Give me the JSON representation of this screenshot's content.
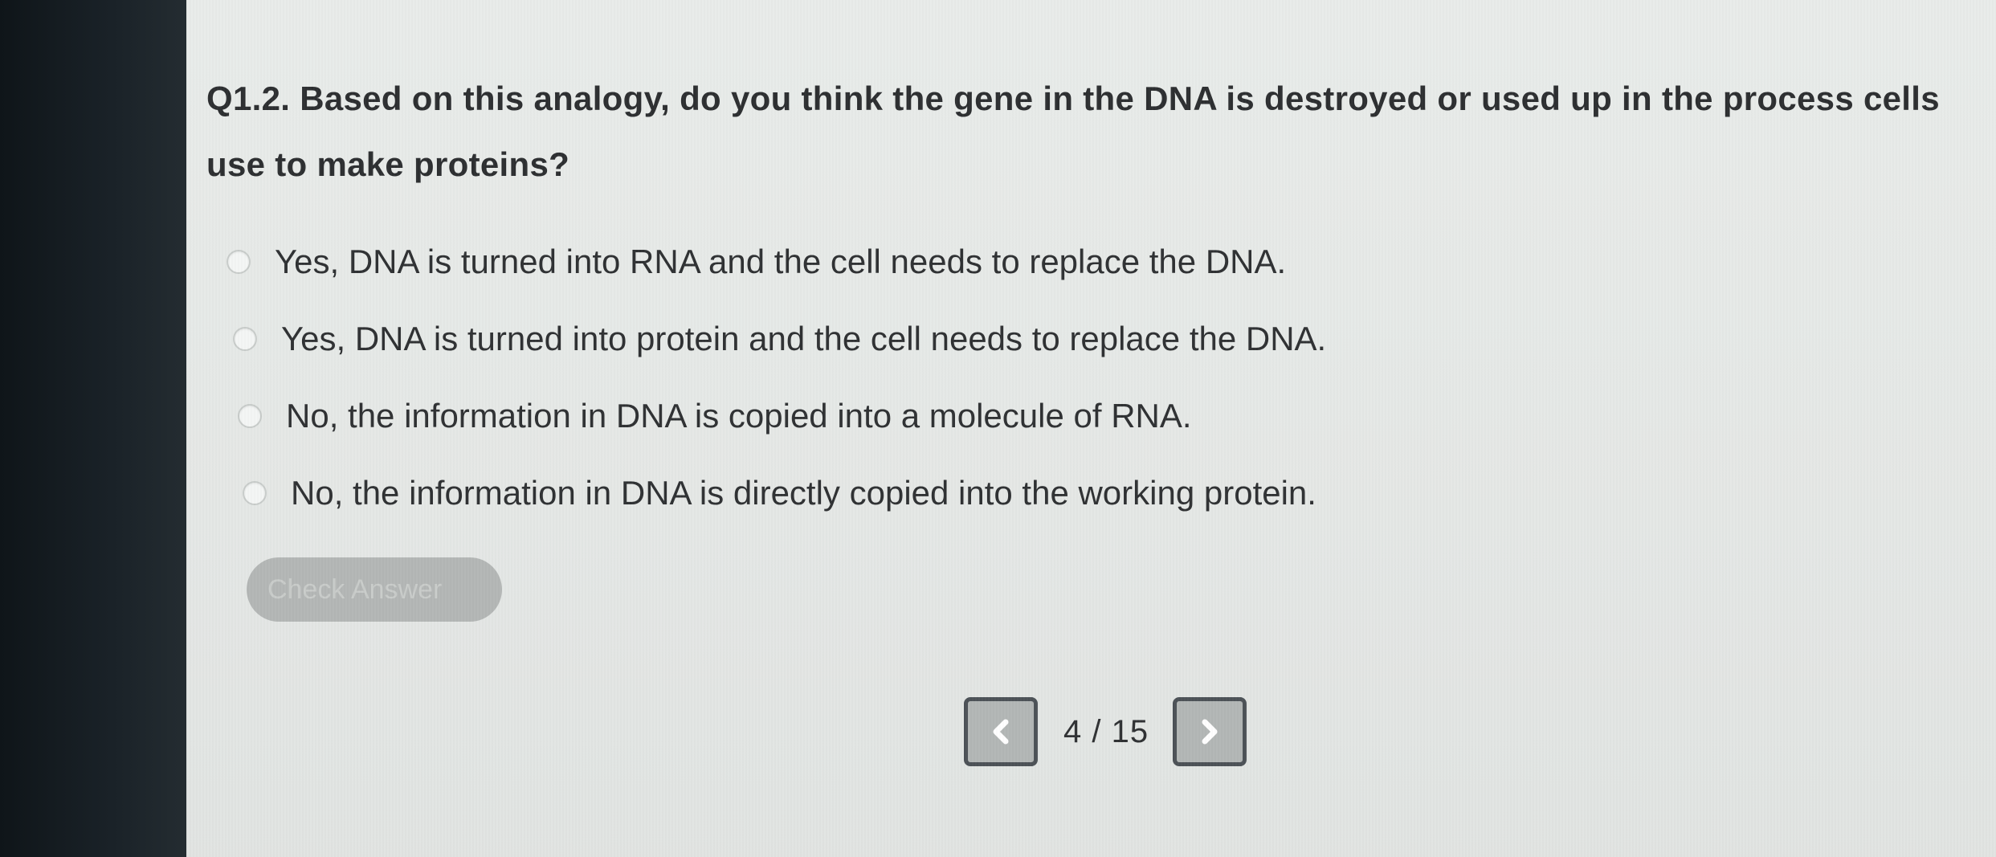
{
  "question": {
    "text": "Q1.2. Based on this analogy, do you think the gene in the DNA is destroyed or used up in the process cells use to make proteins?"
  },
  "options": [
    {
      "label": "Yes, DNA is turned into RNA and the cell needs to replace the DNA."
    },
    {
      "label": "Yes, DNA is turned into protein and the cell needs to replace the DNA."
    },
    {
      "label": "No, the information in DNA is copied into a molecule of RNA."
    },
    {
      "label": "No, the information in DNA is directly copied into the working protein."
    }
  ],
  "check_button": {
    "label": "Check Answer"
  },
  "pagination": {
    "current": "4 / 15"
  },
  "icons": {
    "prev": "chevron-left-icon",
    "next": "chevron-right-icon"
  },
  "colors": {
    "background": "#e7eae8",
    "text": "#2d2f31",
    "button_disabled": "#b4b7b6",
    "nav_border": "#4c5257"
  }
}
